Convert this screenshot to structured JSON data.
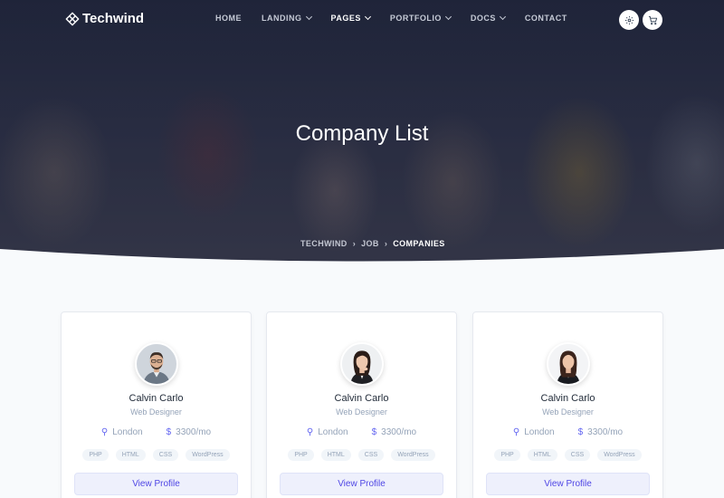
{
  "brand": {
    "name": "Techwind"
  },
  "nav": {
    "items": [
      {
        "label": "HOME",
        "dropdown": false,
        "active": false
      },
      {
        "label": "LANDING",
        "dropdown": true,
        "active": false
      },
      {
        "label": "PAGES",
        "dropdown": true,
        "active": true
      },
      {
        "label": "PORTFOLIO",
        "dropdown": true,
        "active": false
      },
      {
        "label": "DOCS",
        "dropdown": true,
        "active": false
      },
      {
        "label": "CONTACT",
        "dropdown": false,
        "active": false
      }
    ],
    "icons": [
      "settings-icon",
      "cart-icon"
    ]
  },
  "hero": {
    "title": "Company List",
    "breadcrumb": [
      "TECHWIND",
      "JOB",
      "COMPANIES"
    ]
  },
  "cards": [
    {
      "name": "Calvin Carlo",
      "role": "Web Designer",
      "location": "London",
      "salary": "3300/mo",
      "tags": [
        "PHP",
        "HTML",
        "CSS",
        "WordPress"
      ],
      "button": "View Profile"
    },
    {
      "name": "Calvin Carlo",
      "role": "Web Designer",
      "location": "London",
      "salary": "3300/mo",
      "tags": [
        "PHP",
        "HTML",
        "CSS",
        "WordPress"
      ],
      "button": "View Profile"
    },
    {
      "name": "Calvin Carlo",
      "role": "Web Designer",
      "location": "London",
      "salary": "3300/mo",
      "tags": [
        "PHP",
        "HTML",
        "CSS",
        "WordPress"
      ],
      "button": "View Profile"
    }
  ],
  "colors": {
    "accent": "#4f46e5",
    "hero_overlay": "#1f2437",
    "page_bg": "#f8fafc"
  }
}
